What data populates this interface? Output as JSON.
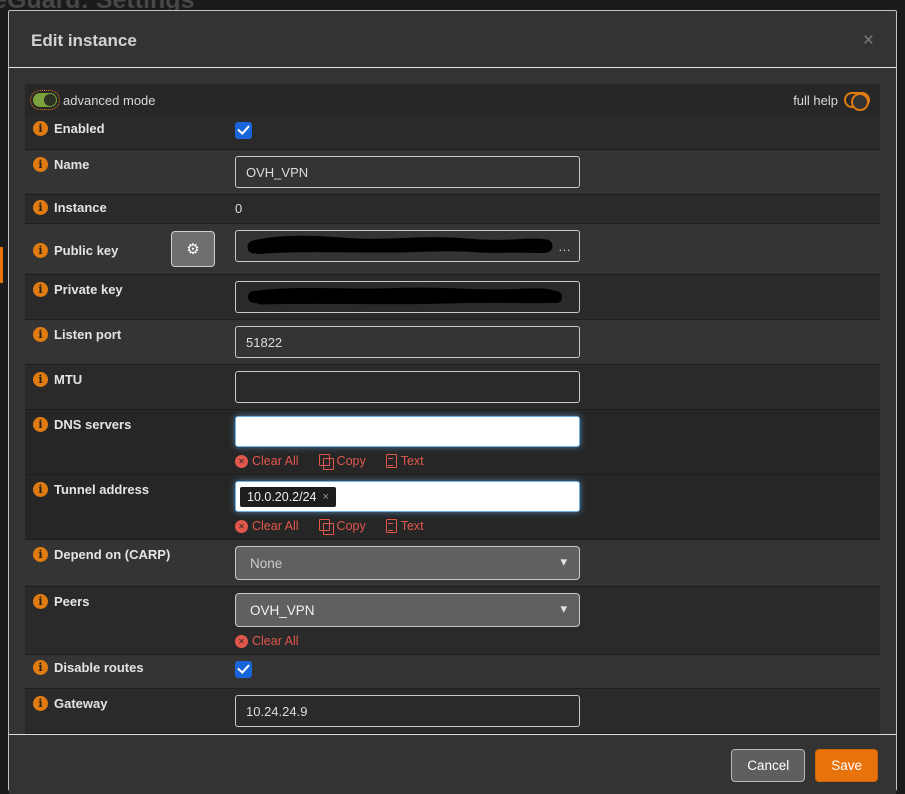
{
  "background": {
    "page_title": "WireGuard: Settings"
  },
  "modal": {
    "title": "Edit instance",
    "close_label": "×",
    "advanced_mode_label": "advanced mode",
    "full_help_label": "full help"
  },
  "action_labels": {
    "clear_all": "Clear All",
    "copy": "Copy",
    "text": "Text"
  },
  "fields": {
    "enabled": {
      "label": "Enabled",
      "checked": true
    },
    "name": {
      "label": "Name",
      "value": "OVH_VPN"
    },
    "instance": {
      "label": "Instance",
      "value": "0"
    },
    "public_key": {
      "label": "Public key",
      "value": "[redacted]",
      "overflow_indicator": "…"
    },
    "private_key": {
      "label": "Private key",
      "value": "[redacted]"
    },
    "listen_port": {
      "label": "Listen port",
      "value": "51822"
    },
    "mtu": {
      "label": "MTU",
      "value": ""
    },
    "dns_servers": {
      "label": "DNS servers",
      "value": ""
    },
    "tunnel_address": {
      "label": "Tunnel address",
      "tokens": [
        "10.0.20.2/24"
      ],
      "token_remove": "×"
    },
    "depend_on_carp": {
      "label": "Depend on (CARP)",
      "selected": "None"
    },
    "peers": {
      "label": "Peers",
      "selected": "OVH_VPN"
    },
    "disable_routes": {
      "label": "Disable routes",
      "checked": true
    },
    "gateway": {
      "label": "Gateway",
      "value": "10.24.24.9"
    }
  },
  "footer": {
    "cancel": "Cancel",
    "save": "Save"
  },
  "colors": {
    "accent_orange": "#e8720c",
    "link_red": "#e2574c",
    "checkbox_blue": "#1765d8",
    "toggle_green": "#79a13c"
  }
}
